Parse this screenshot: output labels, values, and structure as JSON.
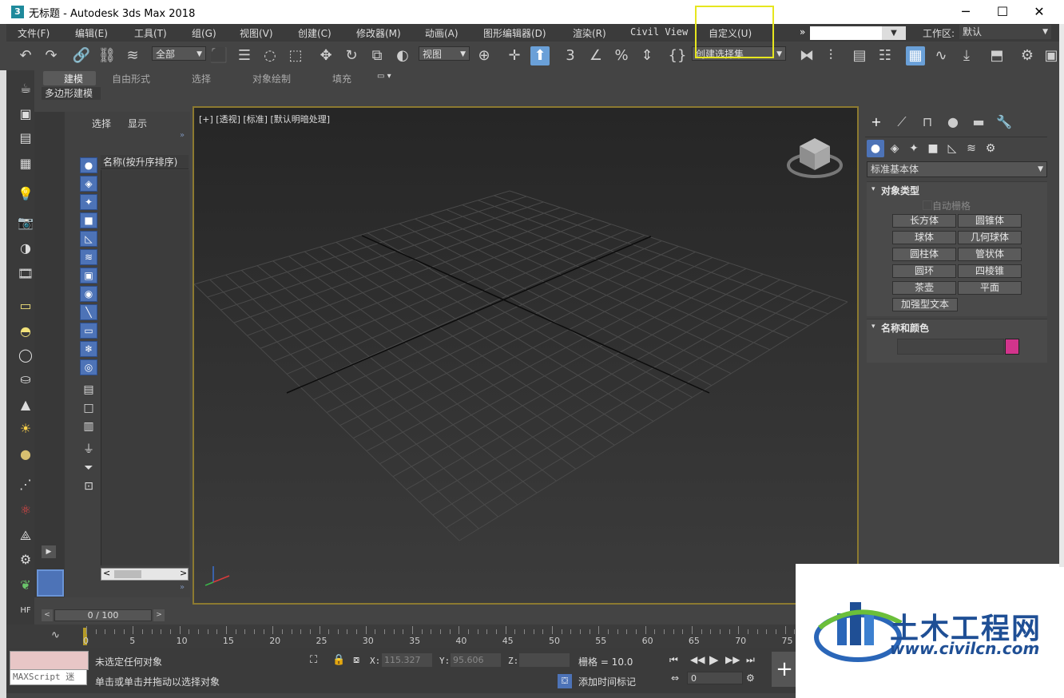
{
  "titlebar": {
    "app_icon": "3",
    "title": "无标题 - Autodesk 3ds Max 2018",
    "min": "─",
    "max": "☐",
    "close": "✕"
  },
  "menu": {
    "items": [
      "文件(F)",
      "编辑(E)",
      "工具(T)",
      "组(G)",
      "视图(V)",
      "创建(C)",
      "修改器(M)",
      "动画(A)",
      "图形编辑器(D)",
      "渲染(R)",
      "Civil View",
      "自定义(U)"
    ],
    "overflow": "»",
    "workspace_label": "工作区:",
    "workspace_value": "默认"
  },
  "toolbar": {
    "filter_value": "全部",
    "refcoord_value": "视图",
    "selection_set_placeholder": "创建选择集"
  },
  "ribbon": {
    "tabs": [
      "建模",
      "自由形式",
      "选择",
      "对象绘制",
      "填充"
    ],
    "sub_label": "多边形建模"
  },
  "explorer": {
    "tab_select": "选择",
    "tab_display": "显示",
    "column_header": "名称(按升序排序)",
    "expand": "»",
    "expand_bottom": "»",
    "scroll_left": "<",
    "scroll_right": ">"
  },
  "viewport": {
    "label": "[+] [透视] [标准] [默认明暗处理]"
  },
  "command_panel": {
    "category_dropdown": "标准基本体",
    "object_type_title": "对象类型",
    "autogrid": "自动栅格",
    "buttons": [
      "长方体",
      "圆锥体",
      "球体",
      "几何球体",
      "圆柱体",
      "管状体",
      "圆环",
      "四棱锥",
      "茶壶",
      "平面"
    ],
    "extended_text": "加强型文本",
    "name_color_title": "名称和颜色",
    "object_color": "#d2348c"
  },
  "timeline": {
    "slider_value": "0 / 100",
    "ticks": [
      "0",
      "5",
      "10",
      "15",
      "20",
      "25",
      "30",
      "35",
      "40",
      "45",
      "50",
      "55",
      "60",
      "65",
      "70",
      "75"
    ]
  },
  "status": {
    "maxscript_label": "MAXScript 迷",
    "line1": "未选定任何对象",
    "line2": "单击或单击并拖动以选择对象",
    "x_label": "X:",
    "x_value": "115.327",
    "y_label": "Y:",
    "y_value": "95.606",
    "z_label": "Z:",
    "z_value": "",
    "grid_text": "栅格 = 10.0",
    "add_time_tag": "添加时间标记",
    "frame_value": "0"
  },
  "watermark": {
    "brand_cn": "土木工程网",
    "url": "www.civilcn.com"
  },
  "colors": {
    "highlight": "#e6e61e",
    "viewport_border": "#8c7a30",
    "accent_blue": "#4d73b7"
  }
}
